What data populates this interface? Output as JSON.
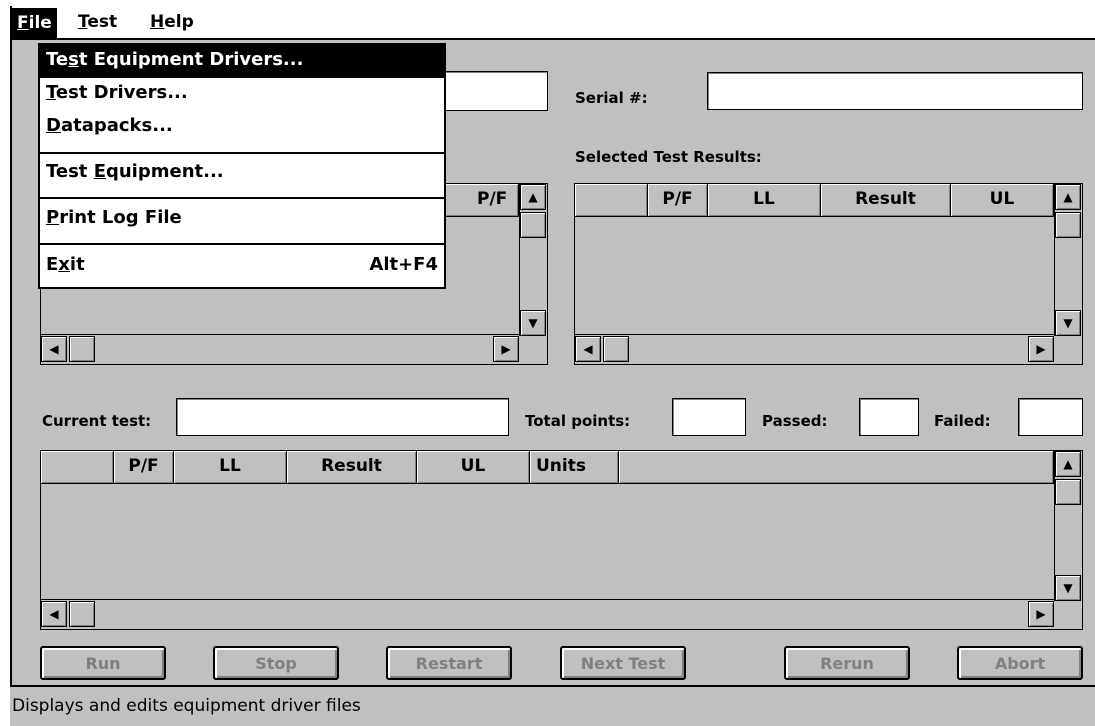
{
  "menubar": {
    "file": {
      "mn": "F",
      "rest": "ile"
    },
    "test": {
      "mn": "T",
      "rest": "est"
    },
    "help": {
      "mn": "H",
      "rest": "elp"
    }
  },
  "file_menu": {
    "items": [
      {
        "pre": "Te",
        "mn": "s",
        "post": "t Equipment Drivers...",
        "accel": ""
      },
      {
        "pre": "",
        "mn": "T",
        "post": "est Drivers...",
        "accel": ""
      },
      {
        "pre": "",
        "mn": "D",
        "post": "atapacks...",
        "accel": ""
      },
      {
        "pre": "Test ",
        "mn": "E",
        "post": "quipment...",
        "accel": ""
      },
      {
        "pre": "",
        "mn": "P",
        "post": "rint Log File",
        "accel": ""
      },
      {
        "pre": "E",
        "mn": "x",
        "post": "it",
        "accel": "Alt+F4"
      }
    ]
  },
  "labels": {
    "serial": "Serial #:",
    "selected_results": "Selected Test Results:",
    "current_test": "Current test:",
    "total_points": "Total points:",
    "passed": "Passed:",
    "failed": "Failed:"
  },
  "fields": {
    "top_left": "",
    "serial": "",
    "current_test": "",
    "total_points": "",
    "passed": "",
    "failed": ""
  },
  "left_grid": {
    "headers": [
      "P/F"
    ]
  },
  "selected_grid": {
    "headers": [
      "",
      "P/F",
      "LL",
      "Result",
      "UL"
    ]
  },
  "current_grid": {
    "headers": [
      "",
      "P/F",
      "LL",
      "Result",
      "UL",
      "Units",
      ""
    ]
  },
  "buttons": {
    "run": "Run",
    "stop": "Stop",
    "restart": "Restart",
    "next_test": "Next Test",
    "rerun": "Rerun",
    "abort": "Abort"
  },
  "status_text": "Displays and edits equipment driver files",
  "icons": {
    "up": "up-arrow-icon",
    "down": "down-arrow-icon",
    "left": "left-arrow-icon",
    "right": "right-arrow-icon"
  }
}
